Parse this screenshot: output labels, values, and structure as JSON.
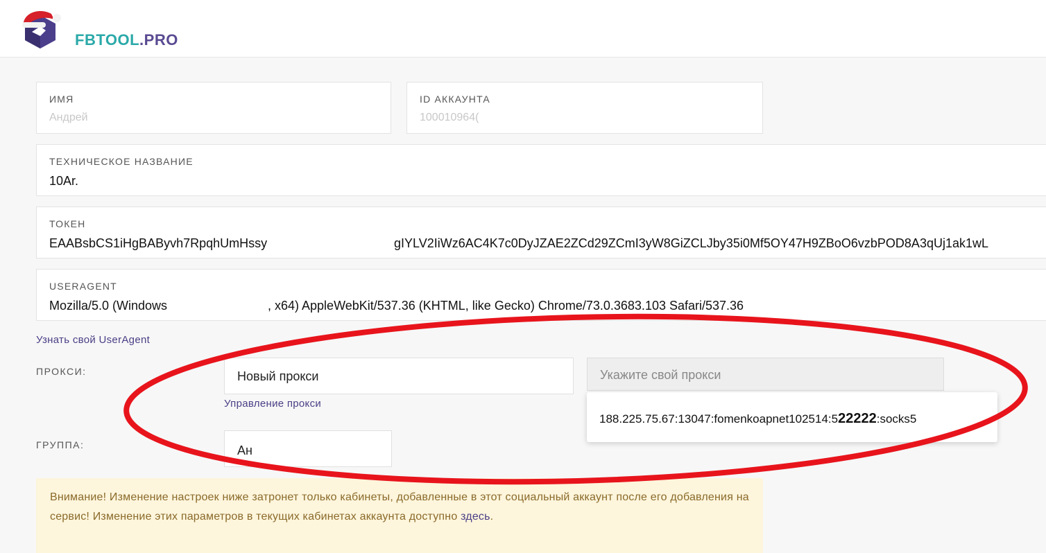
{
  "brand": {
    "prefix": "FBTOOL",
    "suffix": ".PRO"
  },
  "form": {
    "name": {
      "label": "ИМЯ",
      "value": "Андрей"
    },
    "account_id": {
      "label": "ID АККАУНТА",
      "value": "100010964("
    },
    "tech_name": {
      "label": "ТЕХНИЧЕСКОЕ НАЗВАНИЕ",
      "value": "10Ar."
    },
    "token": {
      "label": "ТОКЕН",
      "value_start": "EAABsbCS1iHgBAByvh7RpqhUmHssy",
      "value_end": "gIYLV2IiWz6AC4K7c0DyJZAE2ZCd29ZCmI3yW8GiZCLJby35i0Mf5OY47H9ZBoO6vzbPOD8A3qUj1ak1wL"
    },
    "useragent": {
      "label": "USERAGENT",
      "value_start": "Mozilla/5.0 (Windows",
      "value_end": ", x64) AppleWebKit/537.36 (KHTML, like Gecko) Chrome/73.0.3683.103 Safari/537.36"
    },
    "ua_link": "Узнать свой UserAgent",
    "proxy": {
      "label": "ПРОКСИ:",
      "select_value": "Новый прокси",
      "manage_link": "Управление прокси",
      "input_placeholder": "Укажите свой прокси",
      "suggestion_start": "188.225.75.67:13047:fomenkoapnet102514:5",
      "suggestion_bold": "22222",
      "suggestion_end": ":socks5"
    },
    "group": {
      "label": "ГРУППА:",
      "value": "Ан"
    }
  },
  "warning": {
    "text": "Внимание! Изменение настроек ниже затронет только кабинеты, добавленные в этот социальный аккаунт после его добавления на сервис! Изменение этих параметров в текущих кабинетах аккаунта доступно",
    "link": "здесь",
    "tail": "."
  },
  "colors": {
    "brand_teal": "#2aa9a8",
    "brand_purple": "#5a4a92",
    "annotation_red": "#e8141c"
  }
}
